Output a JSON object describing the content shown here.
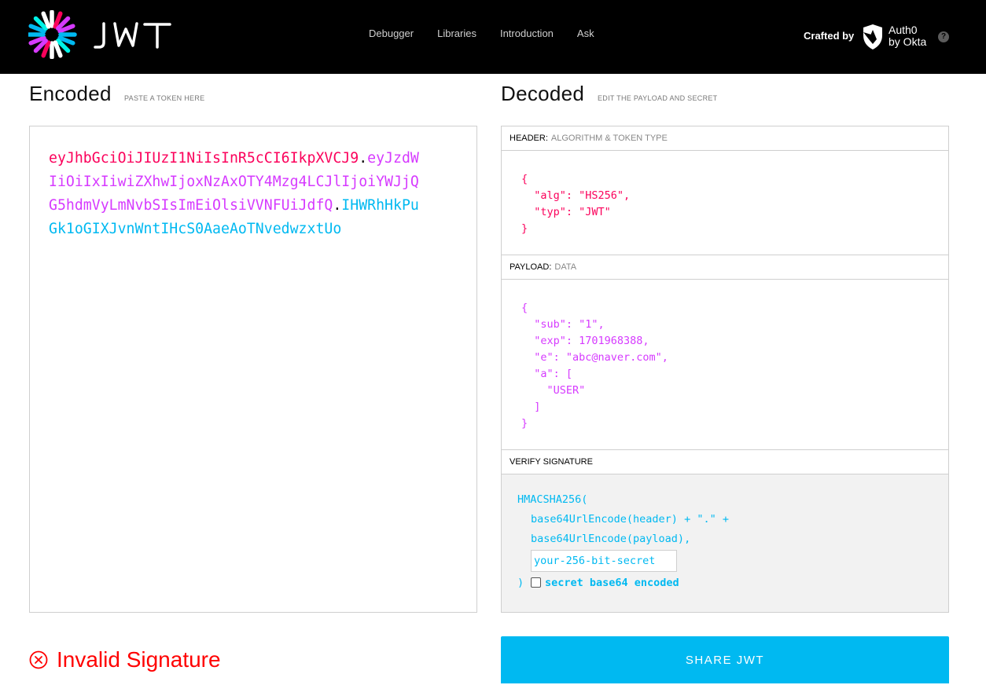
{
  "header": {
    "logo_text": "JWT",
    "nav": [
      "Debugger",
      "Libraries",
      "Introduction",
      "Ask"
    ],
    "crafted_by": "Crafted by",
    "brand_line1": "Auth0",
    "brand_line2": "by Okta",
    "help": "?"
  },
  "encoded": {
    "title": "Encoded",
    "subtitle": "PASTE A TOKEN HERE",
    "token_header": "eyJhbGciOiJIUzI1NiIsInR5cCI6IkpXVCJ9",
    "token_payload": "eyJzdWIiOiIxIiwiZXhwIjoxNzAxOTY4Mzg4LCJlIjoiYWJjQG5hdmVyLmNvbSIsImEiOlsiVVNFUiJdfQ",
    "token_signature": "IHWRhHkPuGk1oGIXJvnWntIHcS0AaeAoTNvedwzxtUo",
    "dot": "."
  },
  "decoded": {
    "title": "Decoded",
    "subtitle": "EDIT THE PAYLOAD AND SECRET",
    "header_section": {
      "label": "HEADER:",
      "sub": "ALGORITHM & TOKEN TYPE"
    },
    "header_json": "{\n  \"alg\": \"HS256\",\n  \"typ\": \"JWT\"\n}",
    "payload_section": {
      "label": "PAYLOAD:",
      "sub": "DATA"
    },
    "payload_json": "{\n  \"sub\": \"1\",\n  \"exp\": 1701968388,\n  \"e\": \"abc@naver.com\",\n  \"a\": [\n    \"USER\"\n  ]\n}",
    "verify_section": {
      "label": "VERIFY SIGNATURE"
    },
    "verify_lines": [
      "HMACSHA256(",
      "base64UrlEncode(header) + \".\" +",
      "base64UrlEncode(payload),"
    ],
    "secret_placeholder": "your-256-bit-secret",
    "close_paren": ")",
    "base64_label": "secret base64 encoded"
  },
  "status": {
    "invalid_text": "Invalid Signature",
    "share_label": "SHARE JWT"
  },
  "colors": {
    "header": "#fb015b",
    "payload": "#d63aff",
    "signature": "#00b9f1",
    "error": "#ff0000"
  }
}
